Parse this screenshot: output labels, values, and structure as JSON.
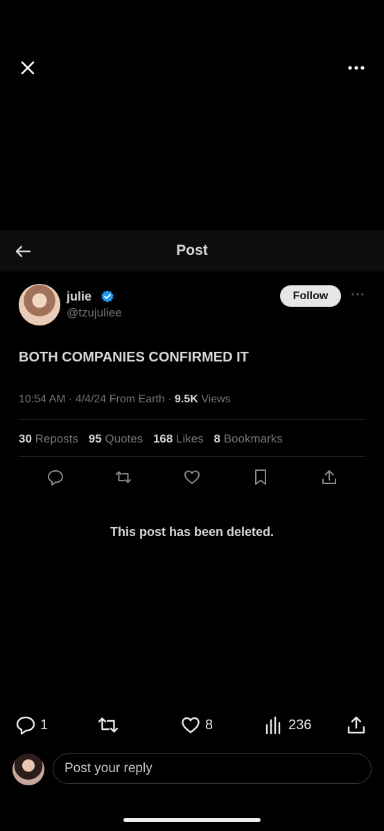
{
  "viewer": {
    "close_icon": "close-icon",
    "more_icon": "more-horizontal-icon"
  },
  "screenshot": {
    "header": {
      "back_icon": "arrow-left-icon",
      "title": "Post"
    },
    "author": {
      "name": "julie",
      "handle": "@tzujuliee",
      "verified": true,
      "verified_color": "#1d9bf0",
      "follow_label": "Follow"
    },
    "post_text": "BOTH COMPANIES CONFIRMED IT",
    "meta": {
      "time": "10:54 AM",
      "date": "4/4/24",
      "source": "From Earth",
      "views_count": "9.5K",
      "views_label": "Views"
    },
    "stats": {
      "reposts_count": "30",
      "reposts_label": "Reposts",
      "quotes_count": "95",
      "quotes_label": "Quotes",
      "likes_count": "168",
      "likes_label": "Likes",
      "bookmarks_count": "8",
      "bookmarks_label": "Bookmarks"
    },
    "deleted_notice": "This post has been deleted."
  },
  "action_bar": {
    "replies": "1",
    "reposts": "",
    "likes": "8",
    "views": "236"
  },
  "reply": {
    "placeholder": "Post your reply"
  },
  "colors": {
    "background": "#000000",
    "text": "#e7e9ea",
    "muted": "#71767b"
  }
}
